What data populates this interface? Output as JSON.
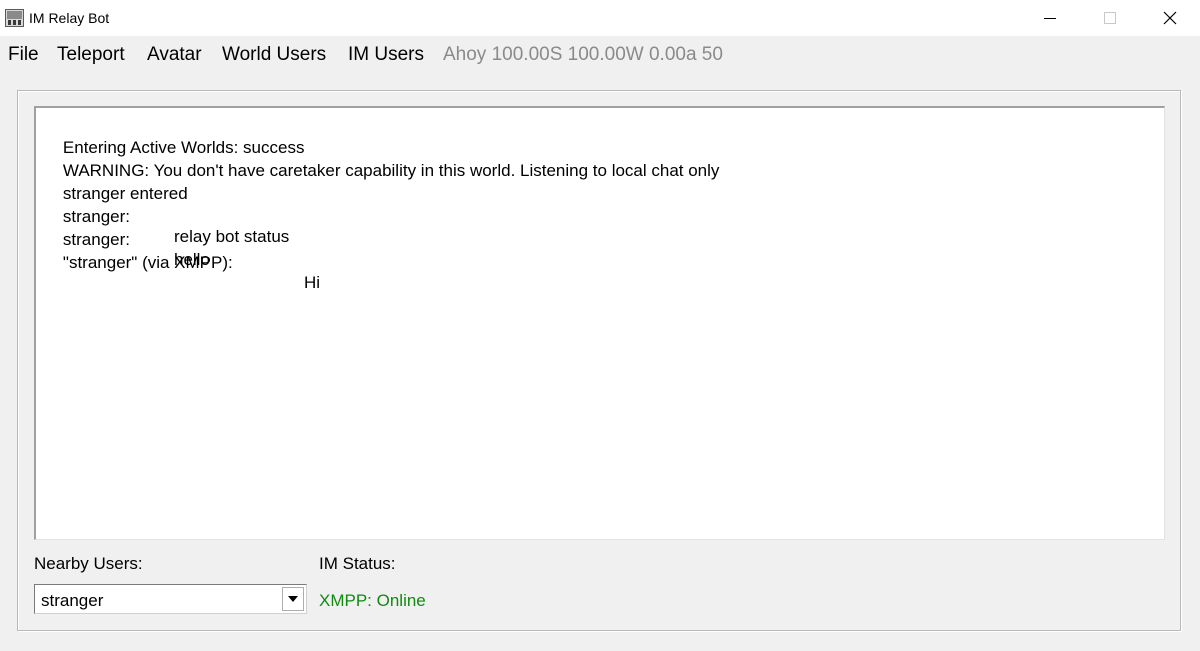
{
  "window": {
    "title": "IM Relay Bot"
  },
  "menu": {
    "file": "File",
    "teleport": "Teleport",
    "avatar": "Avatar",
    "world_users": "World Users",
    "im_users": "IM Users",
    "status_text": "Ahoy 100.00S 100.00W 0.00a 50"
  },
  "log": [
    {
      "col1": "Entering Active Worlds: success",
      "col2": ""
    },
    {
      "col1": "WARNING: You don't have caretaker capability in this world. Listening to local chat only",
      "col2": ""
    },
    {
      "col1": "stranger entered",
      "col2": ""
    },
    {
      "col1": "stranger:",
      "col2": "relay bot status"
    },
    {
      "col1": "stranger:",
      "col2": "hello"
    },
    {
      "col1": "\"stranger\" (via XMPP):",
      "col2": "Hi"
    }
  ],
  "nearby_users": {
    "label": "Nearby Users:",
    "selected": "stranger"
  },
  "im_status": {
    "label": "IM Status:",
    "value": "XMPP: Online"
  },
  "colors": {
    "status_online": "#108a10",
    "menu_status": "#8a8a8a"
  }
}
